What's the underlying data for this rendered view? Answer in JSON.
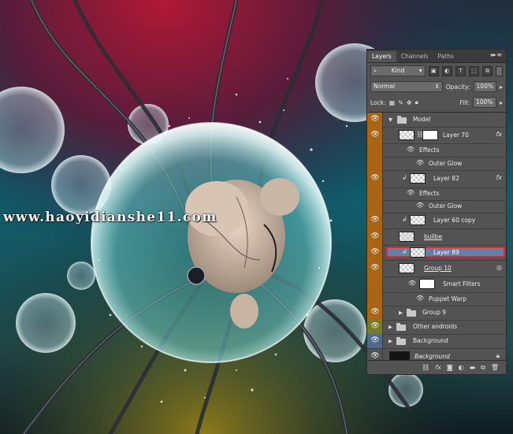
{
  "watermark": "www.haoyidianshe11.com",
  "panel": {
    "tabs": [
      "Layers",
      "Channels",
      "Paths"
    ],
    "active_tab": "Layers",
    "menu_icon": "panel-menu-icon",
    "filter_kind": "Kind",
    "filter_kind_icon": "search-icon",
    "blend_mode": "Normal",
    "opacity_label": "Opacity:",
    "opacity_value": "100%",
    "lock_label": "Lock:",
    "fill_label": "Fill:",
    "fill_value": "100%",
    "colors": {
      "panel_bg": "#535353",
      "selection": "#6680a3",
      "highlight_box": "#e0282c",
      "orange_group": "#a96514",
      "olive": "#7a7a28",
      "blue_bg": "#4f6b8a"
    }
  },
  "layers": [
    {
      "name": "Model",
      "type": "group",
      "expanded": true,
      "visible": true,
      "color": "orange"
    },
    {
      "name": "Layer 70",
      "type": "layer",
      "visible": true,
      "linked_mask": true,
      "fx": "fx",
      "color": "orange"
    },
    {
      "name": "Effects",
      "type": "effects-label",
      "color": "orange"
    },
    {
      "name": "Outer Glow",
      "type": "effect",
      "color": "orange"
    },
    {
      "name": "Layer 82",
      "type": "layer",
      "visible": true,
      "clipped": true,
      "fx": "fx",
      "color": "orange"
    },
    {
      "name": "Effects",
      "type": "effects-label",
      "color": "orange"
    },
    {
      "name": "Outer Glow",
      "type": "effect",
      "color": "orange"
    },
    {
      "name": "Layer 60 copy",
      "type": "layer",
      "visible": true,
      "clipped": true,
      "color": "orange"
    },
    {
      "name": "bullbe",
      "type": "layer",
      "visible": true,
      "color": "orange"
    },
    {
      "name": "Layer 89",
      "type": "layer",
      "visible": true,
      "clipped": true,
      "selected": true,
      "color": "orange"
    },
    {
      "name": "Group 10",
      "type": "smart-object",
      "visible": true,
      "color": "orange"
    },
    {
      "name": "Smart Filters",
      "type": "smart-filters",
      "color": "orange"
    },
    {
      "name": "Puppet Warp",
      "type": "filter",
      "color": "orange"
    },
    {
      "name": "Group 9",
      "type": "group",
      "expanded": false,
      "visible": true,
      "color": "orange"
    },
    {
      "name": "Other androids",
      "type": "group",
      "expanded": false,
      "visible": true,
      "color": "olive"
    },
    {
      "name": "Background",
      "type": "group",
      "expanded": false,
      "visible": true,
      "color": "blue"
    },
    {
      "name": "Background",
      "type": "background",
      "visible": true,
      "locked": true,
      "color": "none"
    }
  ],
  "footer_icons": [
    "link-icon",
    "fx-icon",
    "mask-icon",
    "adjustment-icon",
    "folder-icon",
    "new-layer-icon",
    "trash-icon"
  ],
  "footer_glyphs": {
    "fx": "fx"
  }
}
